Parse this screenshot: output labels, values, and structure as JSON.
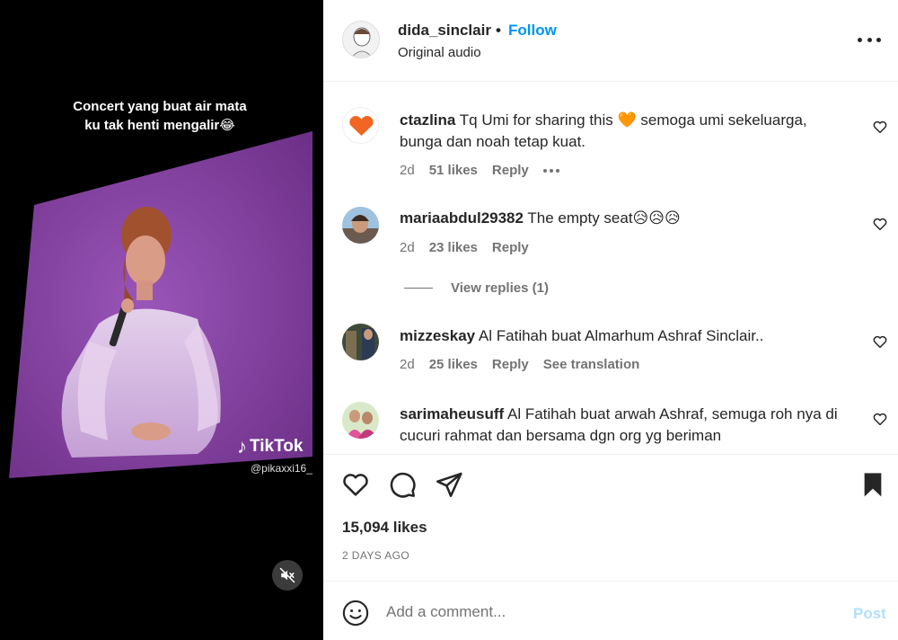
{
  "media": {
    "caption_line1": "Concert yang buat air mata",
    "caption_line2": "ku tak henti mengalir😂",
    "watermark_brand": "TikTok",
    "watermark_handle": "@pikaxxi16_",
    "mute_icon": "muted-speaker-icon"
  },
  "header": {
    "username": "dida_sinclair",
    "separator": "•",
    "follow_label": "Follow",
    "audio_label": "Original audio",
    "more_icon": "more-options-icon"
  },
  "comments": [
    {
      "username": "ctazlina",
      "text_part1": "Tq Umi for sharing this",
      "emoji": "🧡",
      "text_part2": "semoga umi sekeluarga, bunga dan noah tetap kuat.",
      "time": "2d",
      "likes": "51 likes",
      "reply": "Reply"
    },
    {
      "username": "mariaabdul29382",
      "text": "The empty seat😥😥😥",
      "time": "2d",
      "likes": "23 likes",
      "reply": "Reply",
      "view_replies": "View replies (1)"
    },
    {
      "username": "mizzeskay",
      "text": "Al Fatihah buat Almarhum Ashraf Sinclair..",
      "time": "2d",
      "likes": "25 likes",
      "reply": "Reply",
      "translate": "See translation"
    },
    {
      "username": "sarimaheusuff",
      "text": "Al Fatihah buat arwah Ashraf, semuga roh nya di cucuri rahmat dan bersama dgn org yg beriman"
    }
  ],
  "actions": {
    "likes": "15,094 likes",
    "date": "2 DAYS AGO"
  },
  "composer": {
    "placeholder": "Add a comment...",
    "post_label": "Post"
  },
  "colors": {
    "follow": "#0095f6",
    "screen_purple": "#7a3c98",
    "post_disabled": "#b2dffc",
    "heart_orange": "#f26522"
  }
}
